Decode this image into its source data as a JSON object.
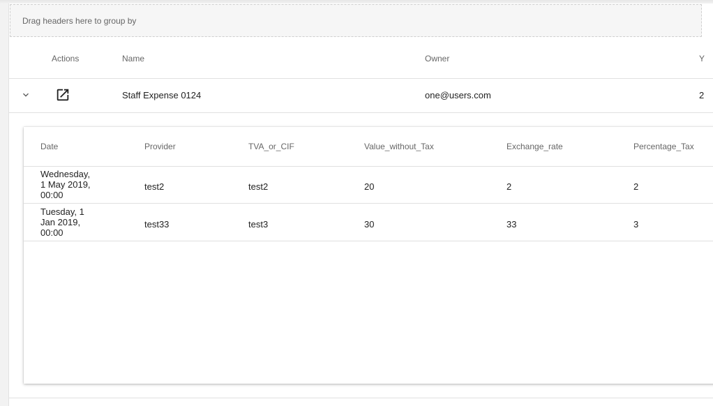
{
  "group_panel": {
    "placeholder": "Drag headers here to group by"
  },
  "main_table": {
    "columns": {
      "actions": "Actions",
      "name": "Name",
      "owner": "Owner",
      "year_truncated": "Y"
    },
    "row": {
      "name": "Staff Expense 0124",
      "owner": "one@users.com",
      "year_truncated": "2"
    },
    "icons": {
      "expand": "chevron-down-icon",
      "open": "open-in-new-icon"
    }
  },
  "detail_table": {
    "columns": {
      "date": "Date",
      "provider": "Provider",
      "tva": "TVA_or_CIF",
      "value": "Value_without_Tax",
      "exchange": "Exchange_rate",
      "percentage": "Percentage_Tax"
    },
    "rows": [
      {
        "date": "Wednesday, 1 May 2019, 00:00",
        "provider": "test2",
        "tva": "test2",
        "value": "20",
        "exchange": "2",
        "percentage": "2"
      },
      {
        "date": "Tuesday, 1 Jan 2019, 00:00",
        "provider": "test33",
        "tva": "test3",
        "value": "30",
        "exchange": "33",
        "percentage": "3"
      }
    ]
  }
}
